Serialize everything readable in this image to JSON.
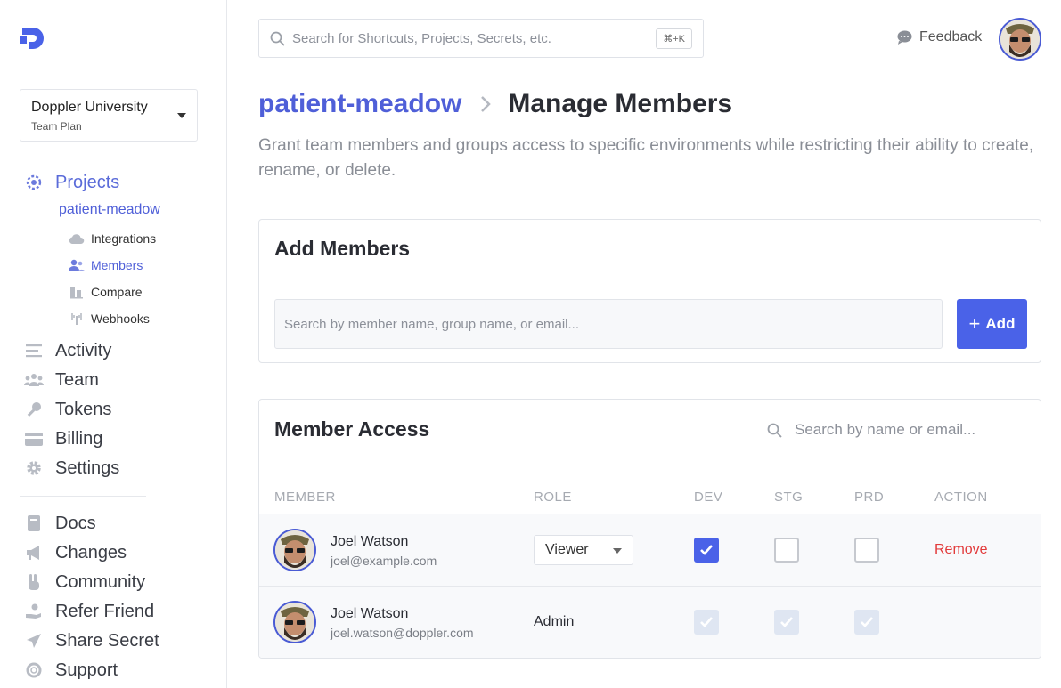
{
  "sidebar": {
    "workspace": {
      "name": "Doppler University",
      "plan": "Team Plan"
    },
    "projects_label": "Projects",
    "project_name": "patient-meadow",
    "sub_items": [
      {
        "label": "Integrations",
        "icon": "cloud-icon"
      },
      {
        "label": "Members",
        "icon": "members-icon"
      },
      {
        "label": "Compare",
        "icon": "compare-icon"
      },
      {
        "label": "Webhooks",
        "icon": "webhook-icon"
      }
    ],
    "main_items": [
      {
        "label": "Activity",
        "icon": "list-icon"
      },
      {
        "label": "Team",
        "icon": "team-icon"
      },
      {
        "label": "Tokens",
        "icon": "key-icon"
      },
      {
        "label": "Billing",
        "icon": "credit-card-icon"
      },
      {
        "label": "Settings",
        "icon": "gear-icon"
      }
    ],
    "secondary_items": [
      {
        "label": "Docs",
        "icon": "book-icon"
      },
      {
        "label": "Changes",
        "icon": "megaphone-icon"
      },
      {
        "label": "Community",
        "icon": "peace-hand-icon"
      },
      {
        "label": "Refer Friend",
        "icon": "hand-coin-icon"
      },
      {
        "label": "Share Secret",
        "icon": "paper-plane-icon"
      },
      {
        "label": "Support",
        "icon": "lifebuoy-icon"
      }
    ]
  },
  "topbar": {
    "search_placeholder": "Search for Shortcuts, Projects, Secrets, etc.",
    "shortcut": "⌘+K",
    "feedback_label": "Feedback"
  },
  "header": {
    "breadcrumb_project": "patient-meadow",
    "title": "Manage Members",
    "description": "Grant team members and groups access to specific environments while restricting their ability to create, rename, or delete."
  },
  "add_members": {
    "title": "Add Members",
    "input_placeholder": "Search by member name, group name, or email...",
    "button_label": "Add"
  },
  "member_access": {
    "title": "Member Access",
    "search_placeholder": "Search by name or email...",
    "columns": [
      "MEMBER",
      "ROLE",
      "DEV",
      "STG",
      "PRD",
      "ACTION"
    ],
    "rows": [
      {
        "name": "Joel Watson",
        "email": "joel@example.com",
        "role": "Viewer",
        "dev": true,
        "stg": false,
        "prd": false,
        "action": "Remove"
      },
      {
        "name": "Joel Watson",
        "email": "joel.watson@doppler.com",
        "role": "Admin",
        "dev": true,
        "stg": true,
        "prd": true,
        "action": ""
      }
    ]
  },
  "colors": {
    "accent": "#4a62e8",
    "link": "#4f5fd8",
    "danger": "#e23b3b"
  }
}
